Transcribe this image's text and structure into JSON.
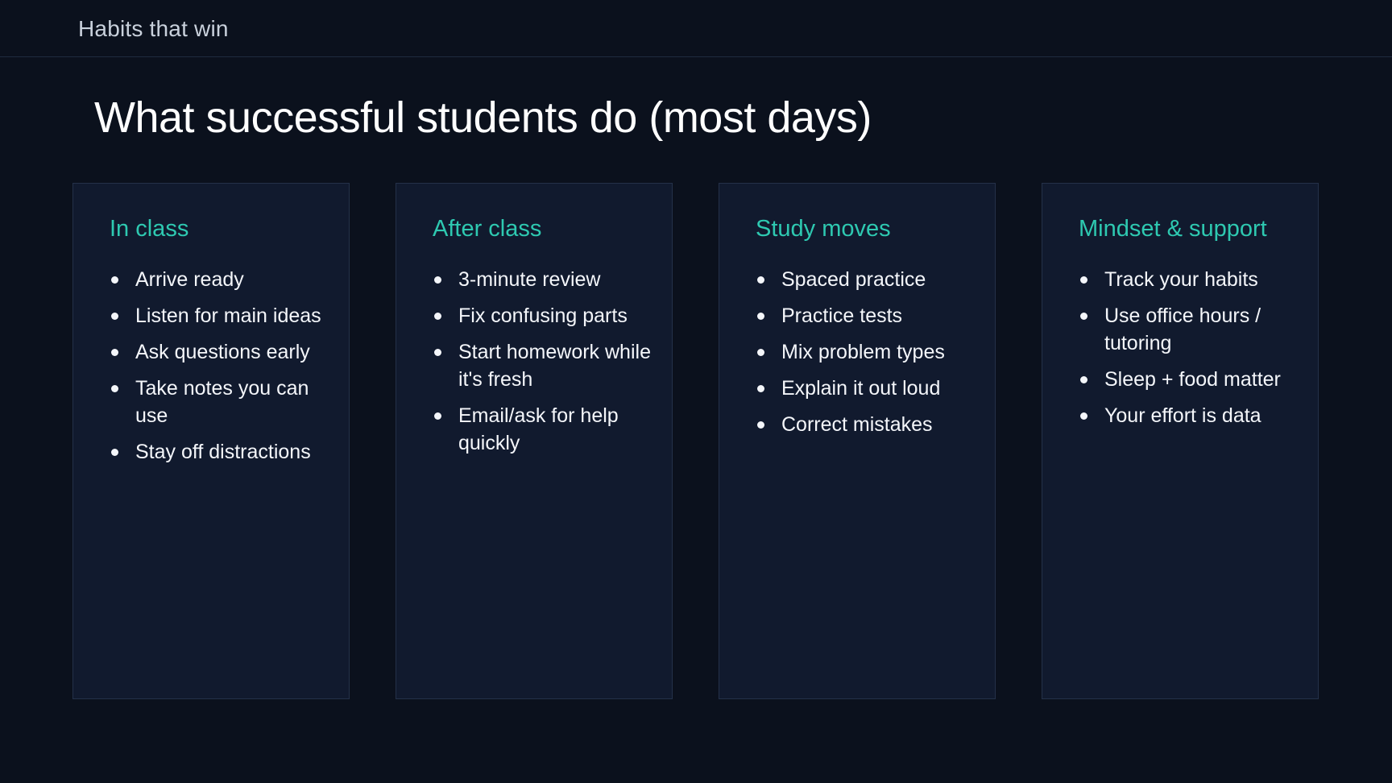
{
  "header": {
    "title": "Habits that win"
  },
  "slide": {
    "title": "What successful students do (most days)"
  },
  "cards": [
    {
      "heading": "In class",
      "items": [
        "Arrive ready",
        "Listen for main ideas",
        "Ask questions early",
        "Take notes you can use",
        "Stay off distractions"
      ]
    },
    {
      "heading": "After class",
      "items": [
        "3-minute review",
        "Fix confusing parts",
        "Start homework while it's fresh",
        "Email/ask for help quickly"
      ]
    },
    {
      "heading": "Study moves",
      "items": [
        "Spaced practice",
        "Practice tests",
        "Mix problem types",
        "Explain it out loud",
        "Correct mistakes"
      ]
    },
    {
      "heading": "Mindset & support",
      "items": [
        "Track your habits",
        "Use office hours / tutoring",
        "Sleep + food matter",
        "Your effort is data"
      ]
    }
  ],
  "colors": {
    "background": "#0b111d",
    "card_background": "#111a2e",
    "accent": "#2ec9b1",
    "text": "#f4f6fa"
  }
}
